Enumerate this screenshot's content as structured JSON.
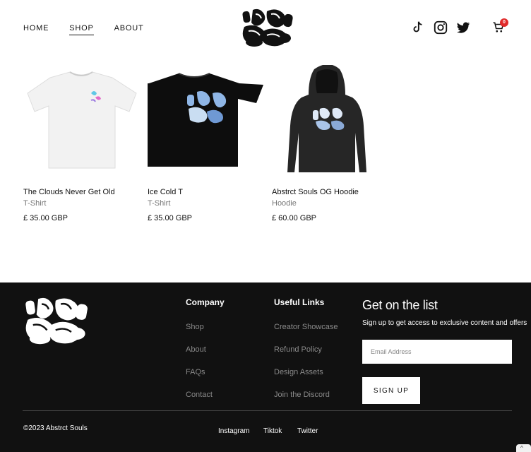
{
  "header": {
    "nav": [
      {
        "label": "HOME"
      },
      {
        "label": "SHOP"
      },
      {
        "label": "ABOUT"
      }
    ],
    "active_nav": "SHOP",
    "cart_count": "0",
    "social_icons": [
      "tiktok-icon",
      "instagram-icon",
      "twitter-icon",
      "cart-icon"
    ]
  },
  "products": [
    {
      "name": "The Clouds Never Get Old",
      "type": "T-Shirt",
      "price": "£ 35.00 GBP",
      "color": "#f2f2f2"
    },
    {
      "name": "Ice Cold T",
      "type": "T-Shirt",
      "price": "£ 35.00 GBP",
      "color": "#0d0d0d"
    },
    {
      "name": "Abstrct Souls OG Hoodie",
      "type": "Hoodie",
      "price": "£ 60.00 GBP",
      "color": "#262626"
    }
  ],
  "footer": {
    "company_heading": "Company",
    "company_links": [
      "Shop",
      "About",
      "FAQs",
      "Contact"
    ],
    "useful_heading": "Useful Links",
    "useful_links": [
      "Creator Showcase",
      "Refund Policy",
      "Design Assets",
      "Join the Discord"
    ],
    "list_heading": "Get on the list",
    "list_text": "Sign up to get access to exclusive content and offers",
    "email_placeholder": "Email Address",
    "signup_label": "SIGN UP",
    "copyright": "©2023 Abstrct Souls",
    "bottom_links": [
      "Instagram",
      "Tiktok",
      "Twitter"
    ]
  },
  "colors": {
    "footer_bg": "#111111",
    "badge": "#e02a2a"
  }
}
